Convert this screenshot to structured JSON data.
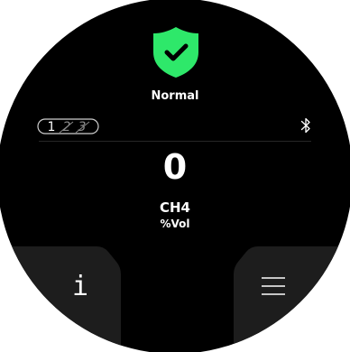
{
  "status": {
    "label": "Normal",
    "icon": "shield-check-icon",
    "color": "#2ee86a"
  },
  "sensor_slots": {
    "labels": [
      "1",
      "2",
      "3"
    ],
    "active": 1
  },
  "bluetooth": {
    "icon": "bluetooth-icon"
  },
  "reading": {
    "value": "0",
    "gas": "CH4",
    "unit": "%Vol"
  },
  "softkeys": {
    "left": {
      "glyph": "i",
      "icon": "info-icon"
    },
    "right": {
      "icon": "menu-icon"
    }
  }
}
